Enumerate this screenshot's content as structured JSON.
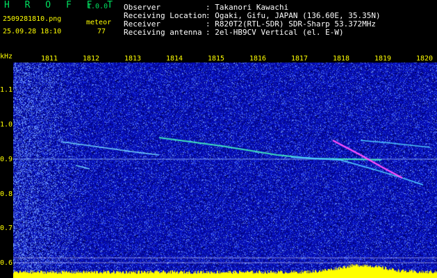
{
  "app": {
    "name": "H R O F F T",
    "version": "1.0.0"
  },
  "file": {
    "name": "2509281810.png",
    "datetime": "25.09.28 18:10"
  },
  "count": {
    "label": "meteor",
    "value": "77"
  },
  "info": {
    "observer_label": "Observer",
    "observer_value": ": Takanori Kawachi",
    "location_label": "Receiving Location",
    "location_value": ": Ogaki, Gifu, JAPAN (136.60E, 35.35N)",
    "receiver_label": "Receiver",
    "receiver_value": ": R820T2(RTL-SDR) SDR-Sharp 53.372MHz",
    "antenna_label": "Receiving antenna",
    "antenna_value": ": 2el-HB9CV Vertical (el. E-W)"
  },
  "axes": {
    "unit": "kHz",
    "y_ticks": [
      "1.1",
      "1.0",
      "0.9",
      "0.8",
      "0.7",
      "0.6"
    ],
    "x_ticks": [
      "1811",
      "1812",
      "1813",
      "1814",
      "1815",
      "1816",
      "1817",
      "1818",
      "1819",
      "1820"
    ]
  },
  "colors": {
    "background": "#000000",
    "axis_text": "#ffff00",
    "header_accent": "#00e060",
    "header_text": "#ffffff",
    "spectrum_noise": "#1a2ad8",
    "echo": "#ff40ff",
    "signal_bar": "#ffff00"
  }
}
